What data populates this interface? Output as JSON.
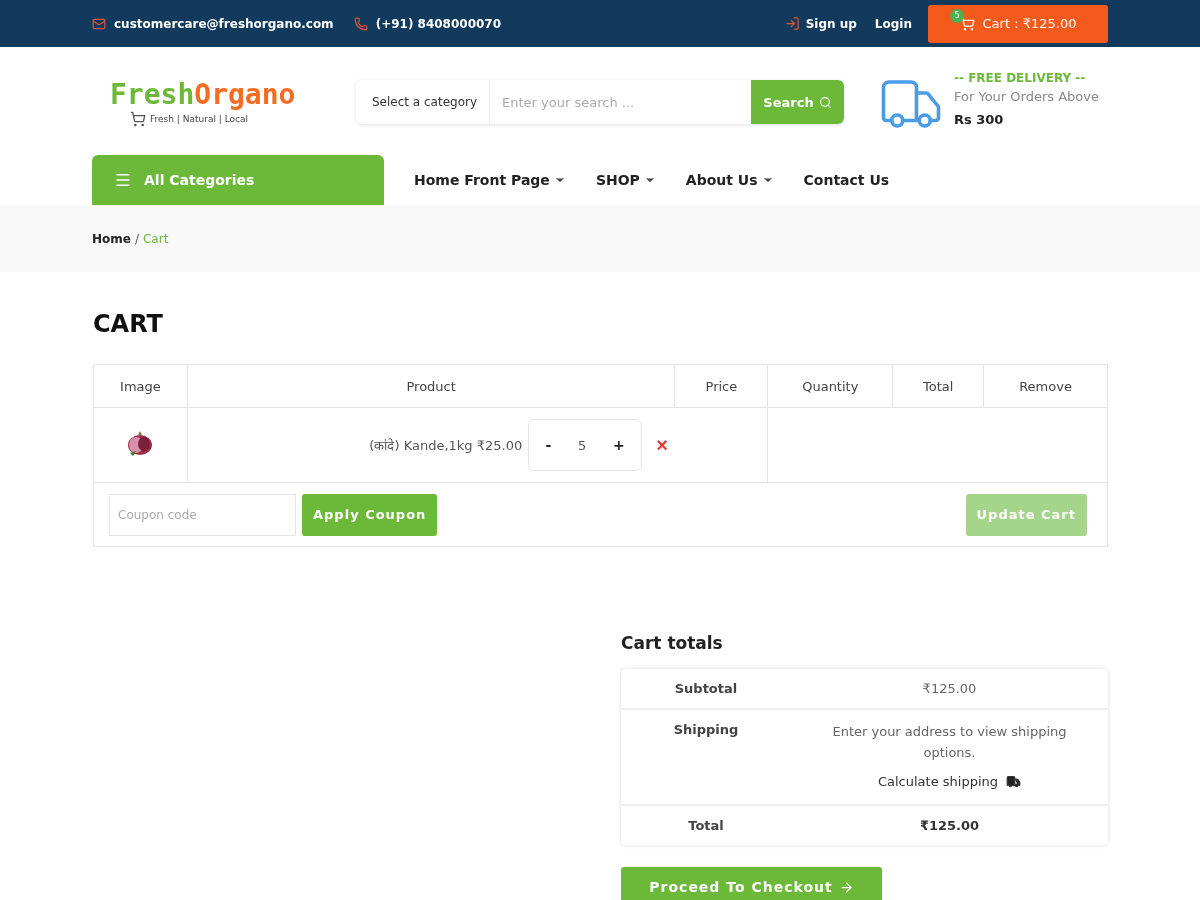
{
  "topbar": {
    "email": "customercare@freshorgano.com",
    "phone": "(+91) 8408000070",
    "signup": "Sign up",
    "login": "Login",
    "cart": {
      "label": "Cart : ₹125.00",
      "count": "5"
    }
  },
  "header": {
    "logo": {
      "first": "Fresh",
      "second": "Organo",
      "tagline": "Fresh | Natural | Local"
    },
    "search": {
      "category": "Select a category",
      "placeholder": "Enter your search ...",
      "button": "Search"
    },
    "delivery": {
      "title": "-- FREE DELIVERY --",
      "line": "For Your Orders Above",
      "amount": "Rs 300"
    }
  },
  "nav": {
    "categories": "All Categories",
    "items": [
      {
        "label": "Home Front Page",
        "dropdown": true
      },
      {
        "label": "SHOP",
        "dropdown": true
      },
      {
        "label": "About Us",
        "dropdown": true
      },
      {
        "label": "Contact Us",
        "dropdown": false
      }
    ]
  },
  "breadcrumb": [
    {
      "label": "Home",
      "selected": false
    },
    {
      "separator": "/",
      "label": "Cart",
      "selected": true
    }
  ],
  "title": "CART",
  "table": {
    "columns": [
      "Image",
      "Product",
      "Price",
      "Quantity",
      "Total",
      "Remove"
    ],
    "rows": [
      {
        "product": "(कांदे) Kande,1kg ₹25.00",
        "minus": "-",
        "quantity": "5",
        "plus": "+",
        "remove": "×"
      }
    ],
    "coupon": {
      "placeholder": "Coupon code",
      "apply": "Apply Coupon",
      "update": "Update Cart",
      "update_disabled": true
    }
  },
  "totals": {
    "title": "Cart totals",
    "rows": [
      {
        "kind": "value",
        "label": "Subtotal",
        "value": "₹125.00"
      },
      {
        "kind": "shipping",
        "label": "Shipping",
        "value": "Enter your address to view shipping options.",
        "link": "Calculate shipping"
      },
      {
        "kind": "value",
        "label": "Total",
        "value": "₹125.00"
      }
    ],
    "checkout": "Proceed To Checkout"
  }
}
